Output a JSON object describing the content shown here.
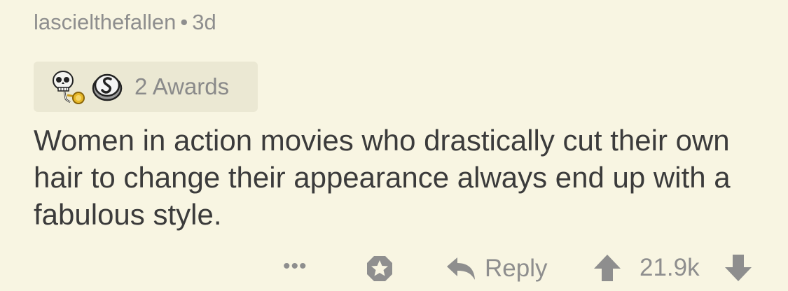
{
  "comment": {
    "author": "lascielthefallen",
    "separator": "•",
    "age": "3d",
    "awards": {
      "icons": [
        "skeleton-trumpet-award-icon",
        "silver-award-icon"
      ],
      "label": "2 Awards"
    },
    "body": "Women in action movies who drastically cut their own hair to change their appearance always end up with a fabulous style.",
    "actions": {
      "more_label": "•••",
      "reply_label": "Reply",
      "score": "21.9k"
    }
  },
  "colors": {
    "background": "#f8f5e2",
    "awards_background": "#ebe8d3",
    "muted_text": "#8e8e8e",
    "body_text": "#3b3b3b"
  }
}
